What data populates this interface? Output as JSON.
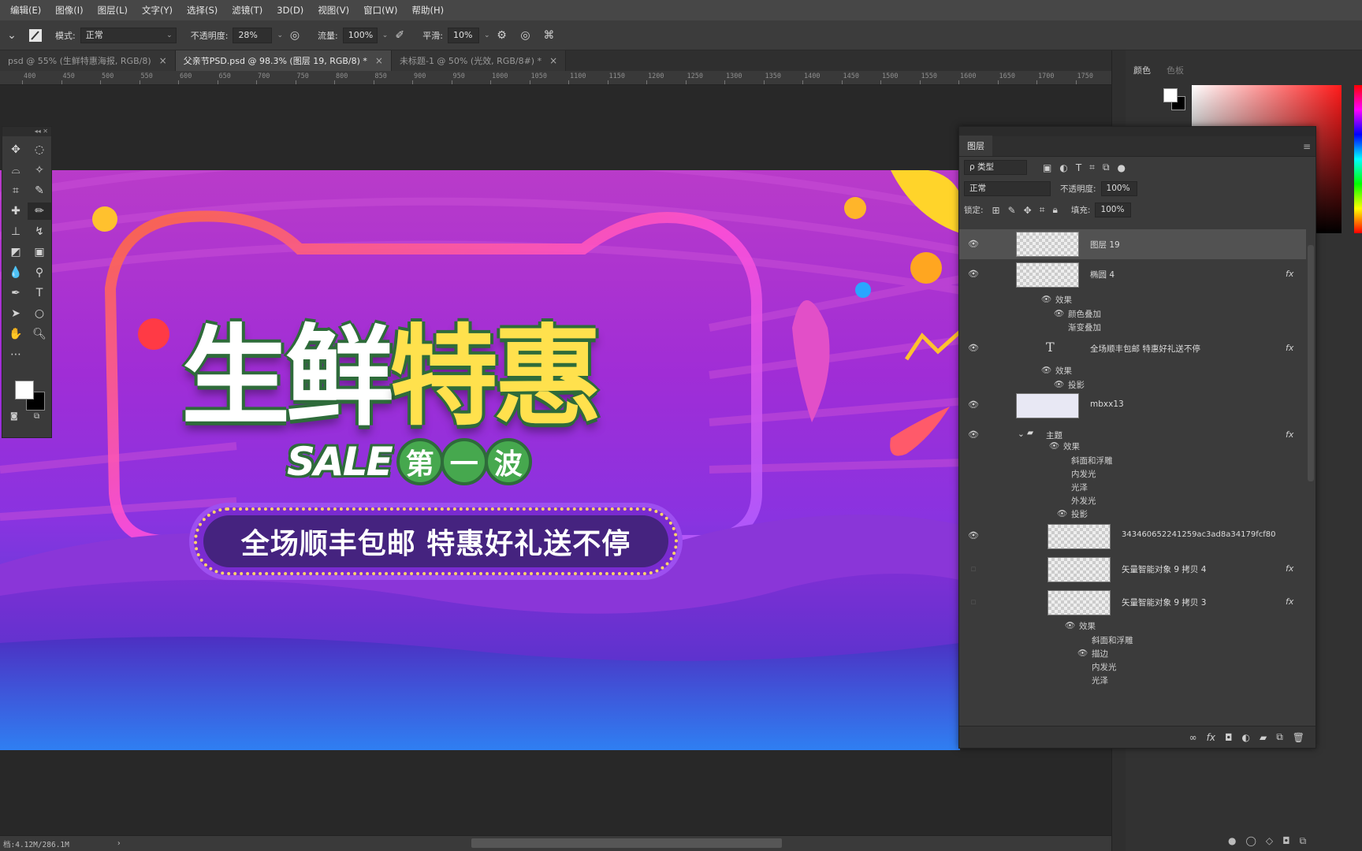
{
  "menu": [
    "编辑(E)",
    "图像(I)",
    "图层(L)",
    "文字(Y)",
    "选择(S)",
    "滤镜(T)",
    "3D(D)",
    "视图(V)",
    "窗口(W)",
    "帮助(H)"
  ],
  "options": {
    "mode_label": "模式:",
    "mode_value": "正常",
    "opacity_label": "不透明度:",
    "opacity_value": "28%",
    "flow_label": "流量:",
    "flow_value": "100%",
    "smooth_label": "平滑:",
    "smooth_value": "10%"
  },
  "tabs": [
    {
      "label": "psd @ 55% (生鲜特惠海报, RGB/8)",
      "close": "×"
    },
    {
      "label": "父亲节PSD.psd @ 98.3% (图层 19, RGB/8) *",
      "close": "×"
    },
    {
      "label": "未标题-1 @ 50% (光效, RGB/8#) *",
      "close": "×"
    }
  ],
  "ruler": [
    "400",
    "450",
    "500",
    "550",
    "600",
    "650",
    "700",
    "750",
    "800",
    "850",
    "900",
    "950",
    "1000",
    "1050",
    "1100",
    "1150",
    "1200",
    "1250",
    "1300",
    "1350",
    "1400",
    "1450",
    "1500",
    "1550",
    "1600",
    "1650",
    "1700",
    "1750"
  ],
  "banner": {
    "title_white": "生鲜",
    "title_yellow": "特惠",
    "sale": "SALE",
    "wave_chars": [
      "第",
      "一",
      "波"
    ],
    "slogan": "全场顺丰包邮 特惠好礼送不停"
  },
  "status": {
    "doc": "档:4.12M/286.1M",
    "arrow": "›"
  },
  "color_panel": {
    "tab1": "颜色",
    "tab2": "色板"
  },
  "layers_panel": {
    "tab": "图层",
    "filter_kind": "ρ 类型",
    "blend_mode": "正常",
    "opacity_label": "不透明度:",
    "opacity_value": "100%",
    "lock_label": "锁定:",
    "fill_label": "填充:",
    "fill_value": "100%",
    "layers": [
      {
        "name": "图层 19",
        "visible": true,
        "selected": true
      },
      {
        "name": "椭圆 4",
        "visible": true,
        "fx": "fx"
      },
      {
        "name": "全场顺丰包邮 特惠好礼送不停",
        "visible": true,
        "fx": "fx",
        "type_icon": "T"
      },
      {
        "name": "mbxx13",
        "visible": true
      },
      {
        "name": "主题",
        "visible": true,
        "fx": "fx",
        "group": true
      },
      {
        "name": "343460652241259ac3ad8a34179fcf80",
        "visible": true
      },
      {
        "name": "矢量智能对象 9 拷贝 4",
        "visible": false,
        "fx": "fx"
      },
      {
        "name": "矢量智能对象 9 拷贝 3",
        "visible": false,
        "fx": "fx"
      }
    ],
    "effects": {
      "e1_title": "效果",
      "e1_items": [
        "颜色叠加",
        "渐变叠加"
      ],
      "e2_title": "效果",
      "e2_items": [
        "投影"
      ],
      "e3_title": "效果",
      "e3_items": [
        "斜面和浮雕",
        "内发光",
        "光泽",
        "外发光",
        "投影"
      ],
      "e4_title": "效果",
      "e4_items": [
        "斜面和浮雕",
        "描边",
        "内发光",
        "光泽"
      ]
    }
  }
}
